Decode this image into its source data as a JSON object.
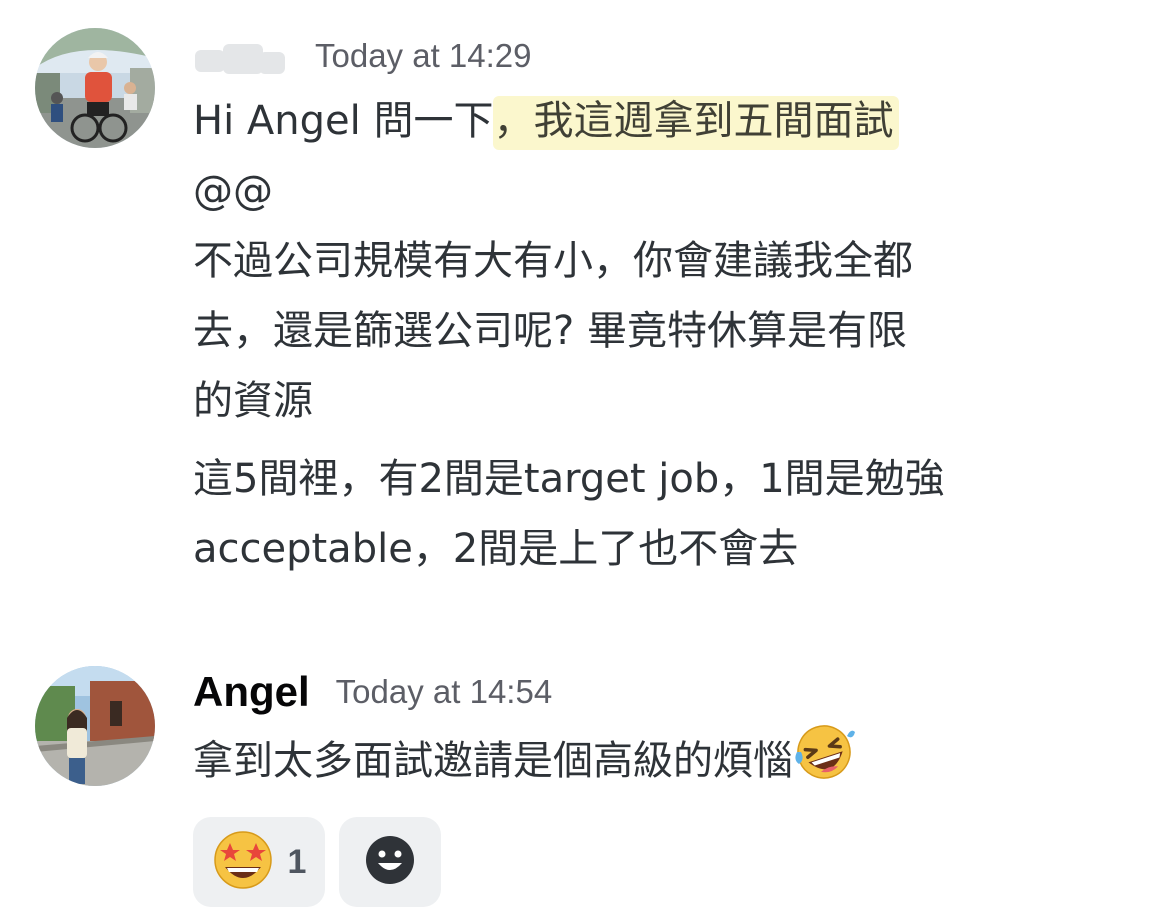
{
  "messages": [
    {
      "author": "",
      "author_obscured": true,
      "timestamp": "Today at 14:29",
      "avatar": "cyclist-photo-avatar",
      "lines": {
        "l1_pre": "Hi Angel 問一下",
        "l1_mark": "，我這週拿到五間面試",
        "l2": "@@",
        "l3": "不過公司規模有大有小，你會建議我全都",
        "l4": "去，還是篩選公司呢? 畢竟特休算是有限",
        "l5": "的資源",
        "l6": "這5間裡，有2間是target job，1間是勉強",
        "l7": "acceptable，2間是上了也不會去"
      }
    },
    {
      "author": "Angel",
      "timestamp": "Today at 14:54",
      "avatar": "woman-photo-avatar",
      "text": "拿到太多面試邀請是個高級的煩惱",
      "trailing_emoji": "rolling-on-floor-laughing-emoji"
    }
  ],
  "reactions": [
    {
      "emoji": "star-struck-emoji",
      "count": "1"
    },
    {
      "emoji": "add-reaction-icon",
      "count": ""
    }
  ],
  "colors": {
    "text": "#2e3338",
    "timestamp": "#5c5e66",
    "highlight": "#fbf7cd",
    "reaction_bg": "#eef0f2"
  }
}
